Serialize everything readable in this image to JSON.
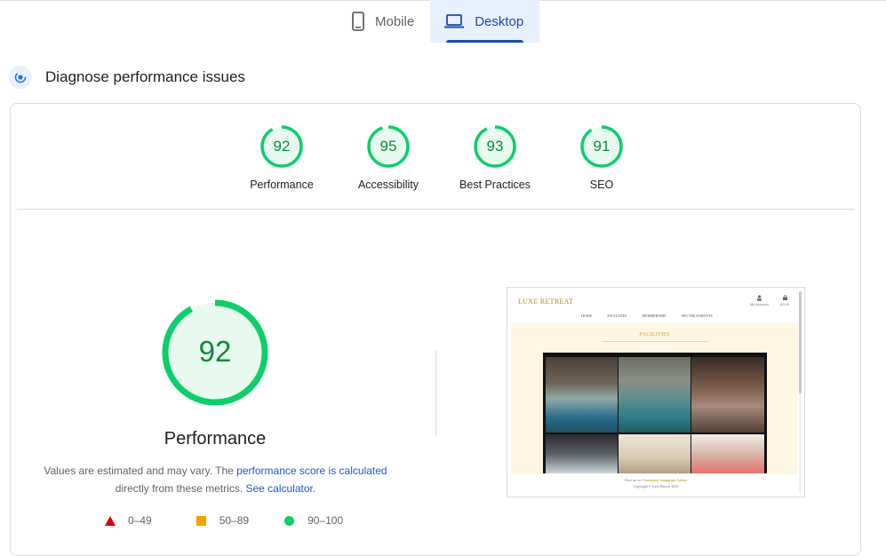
{
  "tabs": [
    {
      "label": "Mobile",
      "icon": "phone-icon",
      "active": false
    },
    {
      "label": "Desktop",
      "icon": "laptop-icon",
      "active": true
    }
  ],
  "section": {
    "title": "Diagnose performance issues",
    "icon": "diagnose-icon"
  },
  "categories": [
    {
      "score": "92",
      "label": "Performance",
      "fraction": 0.92
    },
    {
      "score": "95",
      "label": "Accessibility",
      "fraction": 0.95
    },
    {
      "score": "93",
      "label": "Best Practices",
      "fraction": 0.93
    },
    {
      "score": "91",
      "label": "SEO",
      "fraction": 0.91
    }
  ],
  "main": {
    "score": "92",
    "fraction": 0.92,
    "title": "Performance",
    "note_prefix": "Values are estimated and may vary. The ",
    "note_link": "performance score is calculated",
    "note_middle": "directly from these metrics. ",
    "note_link2": "See calculator."
  },
  "legend": [
    {
      "shape": "triangle",
      "range": "0–49",
      "color": "#e00000"
    },
    {
      "shape": "square",
      "range": "50–89",
      "color": "#f9a100"
    },
    {
      "shape": "circle",
      "range": "90–100",
      "color": "#0cce6b"
    }
  ],
  "colors": {
    "pass": "#0cce6b",
    "pass_text": "#0a8a3c",
    "pass_bg": "#e8faf0",
    "link": "#1a56d6",
    "tab_active": "#1a4ba5"
  },
  "preview": {
    "brand": "LUXE RETREAT",
    "account": "My Account",
    "cart": "£0.00",
    "nav": [
      "HOME",
      "FACILITIES",
      "MEMBERSHIP",
      "SPA TREATMENTS"
    ],
    "heading": "FACILITIES",
    "find_us": "Find us on:",
    "social": [
      "Facebook",
      "Instagram",
      "Twitter"
    ],
    "copyright": "Copyright © Luxe Retreat 2023"
  }
}
